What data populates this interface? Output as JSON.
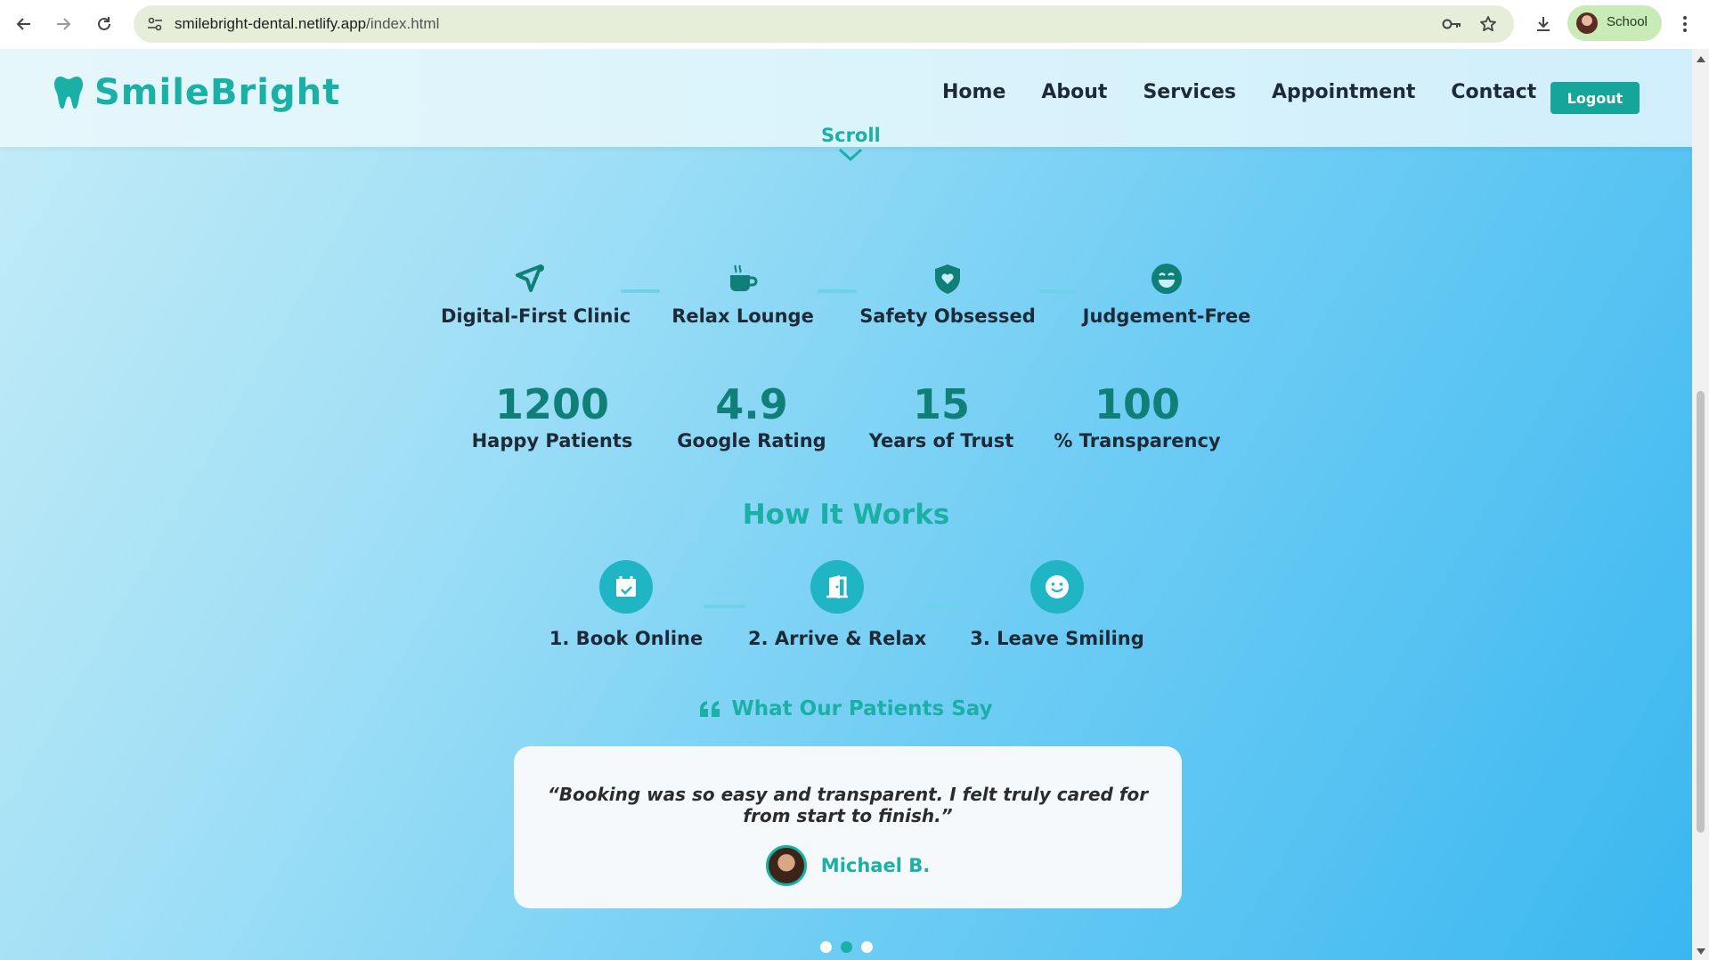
{
  "browser": {
    "url_host": "smilebright-dental.netlify.app",
    "url_path": "/index.html",
    "profile_label": "School"
  },
  "header": {
    "brand": "SmileBright",
    "nav": [
      "Home",
      "About",
      "Services",
      "Appointment",
      "Contact"
    ],
    "logout_label": "Logout",
    "scroll_label": "Scroll"
  },
  "features": [
    {
      "label": "Digital-First Clinic",
      "icon": "send-icon"
    },
    {
      "label": "Relax Lounge",
      "icon": "coffee-icon"
    },
    {
      "label": "Safety Obsessed",
      "icon": "shield-heart-icon"
    },
    {
      "label": "Judgement-Free",
      "icon": "smile-icon"
    }
  ],
  "stats": [
    {
      "value": "1200",
      "caption": "Happy Patients"
    },
    {
      "value": "4.9",
      "caption": "Google Rating"
    },
    {
      "value": "15",
      "caption": "Years of Trust"
    },
    {
      "value": "100",
      "caption": "% Transparency"
    }
  ],
  "how": {
    "title": "How It Works",
    "steps": [
      {
        "label": "1. Book Online",
        "icon": "calendar-check-icon"
      },
      {
        "label": "2. Arrive & Relax",
        "icon": "door-open-icon"
      },
      {
        "label": "3. Leave Smiling",
        "icon": "smile-icon"
      }
    ]
  },
  "testimonials": {
    "title": "What Our Patients Say",
    "quote": "“Booking was so easy and transparent. I felt truly cared for from start to finish.”",
    "author": "Michael B.",
    "active_slide": 2,
    "slide_count": 3
  },
  "colors": {
    "accent": "#1bb0a5",
    "dark_teal": "#107f77",
    "text": "#1e2a38"
  }
}
